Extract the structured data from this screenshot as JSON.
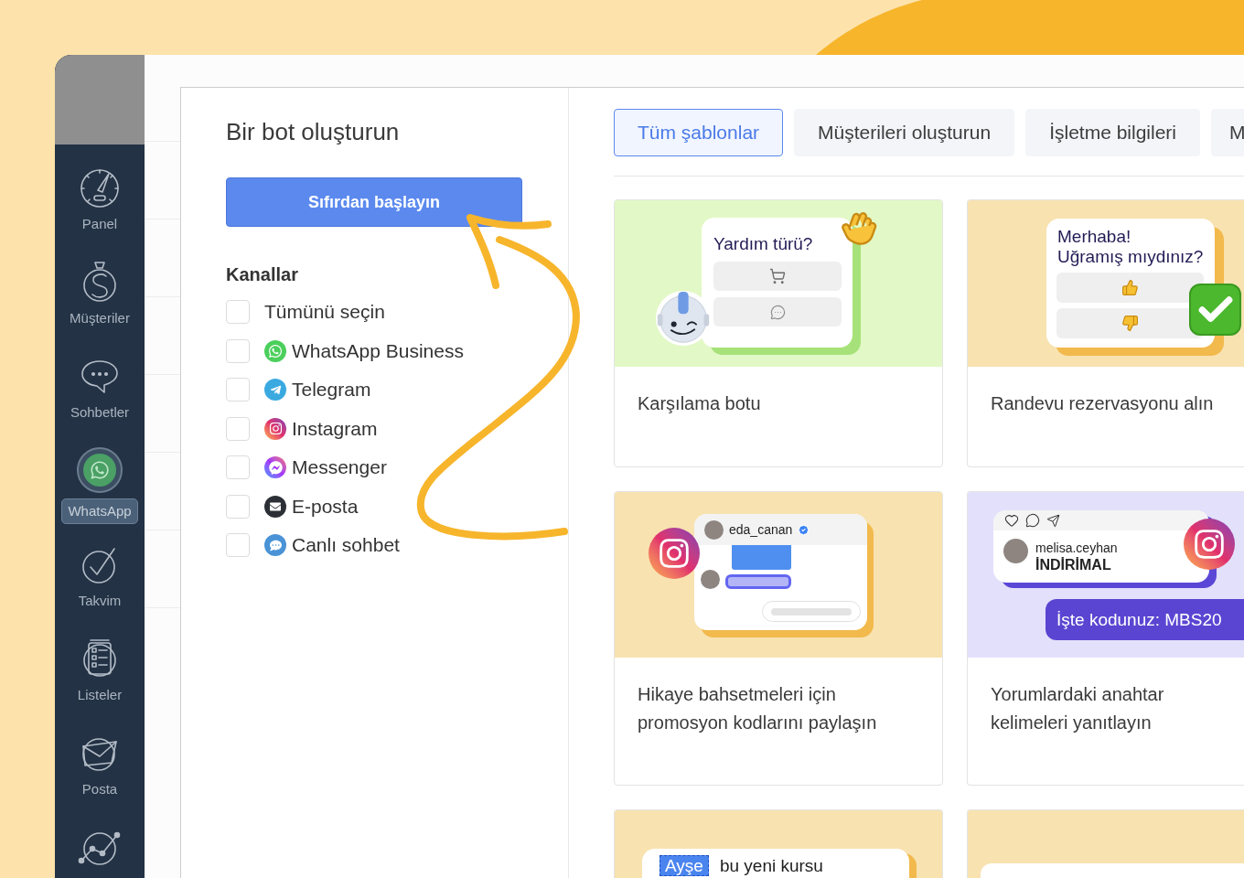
{
  "sidebar": {
    "items": [
      {
        "label": "Panel",
        "kind": "gauge",
        "selected": false
      },
      {
        "label": "Müşteriler",
        "kind": "money",
        "selected": false
      },
      {
        "label": "Sohbetler",
        "kind": "chat",
        "selected": false
      },
      {
        "label": "WhatsApp",
        "kind": "whatsapp",
        "selected": true
      },
      {
        "label": "Takvim",
        "kind": "check",
        "selected": false
      },
      {
        "label": "Listeler",
        "kind": "list",
        "selected": false
      },
      {
        "label": "Posta",
        "kind": "mail",
        "selected": false
      },
      {
        "kind": "chart",
        "selected": false
      }
    ]
  },
  "panel": {
    "title": "Bir bot oluşturun",
    "start_button": "Sıfırdan başlayın",
    "channels_heading": "Kanallar",
    "channels": [
      {
        "label": "Tümünü seçin",
        "kind": "all",
        "checked": false
      },
      {
        "label": "WhatsApp Business",
        "kind": "whatsapp",
        "checked": false
      },
      {
        "label": "Telegram",
        "kind": "telegram",
        "checked": false
      },
      {
        "label": "Instagram",
        "kind": "instagram",
        "checked": false
      },
      {
        "label": "Messenger",
        "kind": "messenger",
        "checked": false
      },
      {
        "label": "E-posta",
        "kind": "email",
        "checked": false
      },
      {
        "label": "Canlı sohbet",
        "kind": "livechat",
        "checked": false
      }
    ]
  },
  "tabs": [
    {
      "label": "Tüm şablonlar",
      "selected": true
    },
    {
      "label": "Müşterileri oluşturun",
      "selected": false
    },
    {
      "label": "İşletme bilgileri",
      "selected": false
    },
    {
      "label": "M",
      "selected": false
    }
  ],
  "templates": [
    {
      "kind": "welcome",
      "title": "Karşılama botu",
      "preview": {
        "question": "Yardım türü?"
      }
    },
    {
      "kind": "booking",
      "title": "Randevu rezervasyonu alın",
      "preview": {
        "greeting": "Merhaba!",
        "question": "Uğramış mıydınız?"
      }
    },
    {
      "kind": "story_mention",
      "title": "Hikaye bahsetmeleri için promosyon kodlarını paylaşın",
      "preview": {
        "username": "eda_canan"
      }
    },
    {
      "kind": "comment_keywords",
      "title": "Yorumlardaki anahtar kelimeleri yanıtlayın",
      "preview": {
        "username": "melisa.ceyhan",
        "comment": "İNDİRİMAL",
        "reply": "İşte kodunuz: MBS20"
      }
    },
    {
      "kind": "course",
      "preview": {
        "name": "Ayşe",
        "message": "bu yeni kursu"
      }
    },
    {
      "kind": "blank_bubble"
    }
  ]
}
